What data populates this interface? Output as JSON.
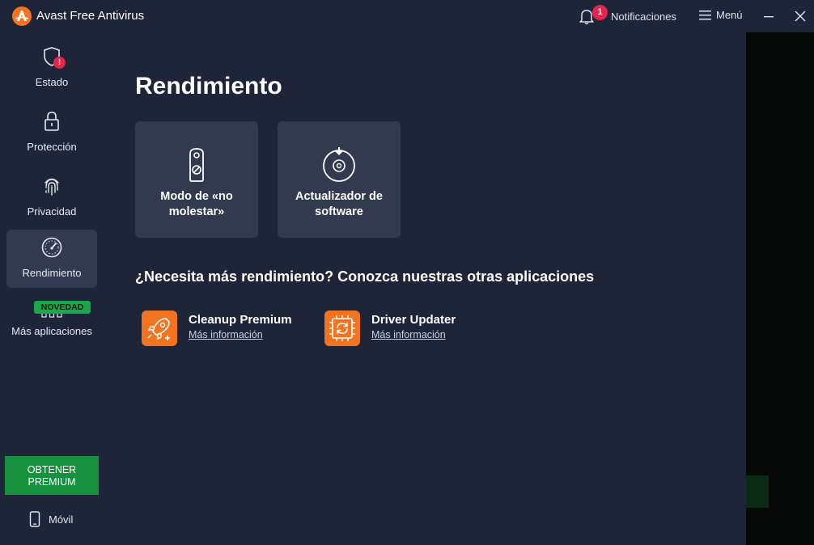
{
  "window": {
    "title": "Avast Free Antivirus",
    "notifications": {
      "count": "1",
      "label": "Notificaciones"
    },
    "menu_label": "Menú"
  },
  "sidebar": {
    "items": [
      {
        "id": "estado",
        "label": "Estado",
        "icon": "shield-icon",
        "alert": "!"
      },
      {
        "id": "proteccion",
        "label": "Protección",
        "icon": "lock-icon"
      },
      {
        "id": "privacidad",
        "label": "Privacidad",
        "icon": "fingerprint-icon"
      },
      {
        "id": "rendimiento",
        "label": "Rendimiento",
        "icon": "speedometer-icon",
        "active": true
      }
    ],
    "more_apps": {
      "badge": "NOVEDAD",
      "label": "Más aplicaciones",
      "icon": "grid-icon"
    },
    "premium_button": "OBTENER PREMIUM",
    "mobile_label": "Móvil"
  },
  "main": {
    "title": "Rendimiento",
    "cards": [
      {
        "label": "Modo de «no molestar»",
        "icon": "door-hanger-icon"
      },
      {
        "label": "Actualizador de software",
        "icon": "disc-update-icon"
      }
    ],
    "section_title": "¿Necesita más rendimiento? Conozca nuestras otras aplicaciones",
    "apps": [
      {
        "name": "Cleanup Premium",
        "link": "Más información",
        "icon": "rocket-icon"
      },
      {
        "name": "Driver Updater",
        "link": "Más información",
        "icon": "chip-refresh-icon"
      }
    ]
  },
  "colors": {
    "background": "#1e2538",
    "card": "#323a4f",
    "accent_orange": "#f27420",
    "premium_green": "#16913d",
    "alert_red": "#e0264a"
  }
}
